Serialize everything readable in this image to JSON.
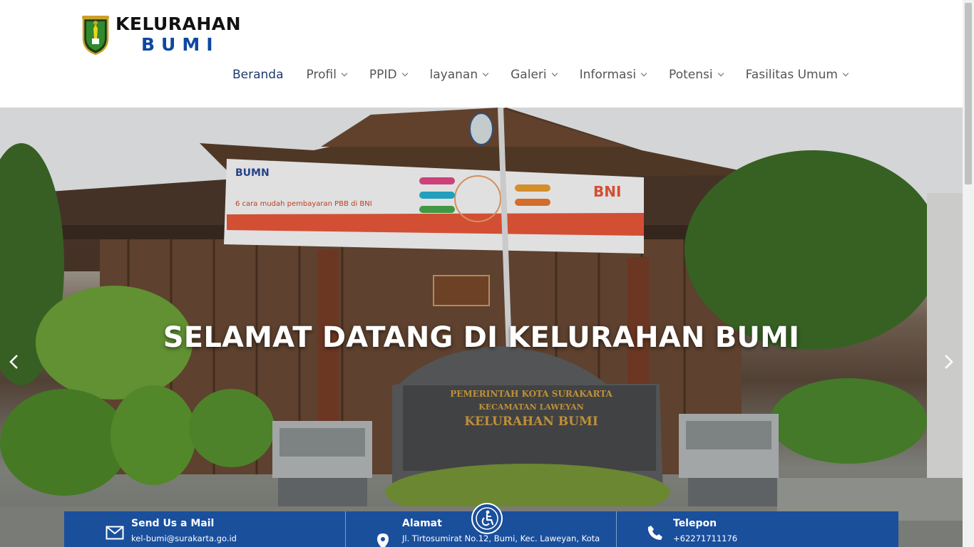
{
  "brand": {
    "name_top": "KELURAHAN",
    "name_bottom": "BUMI"
  },
  "nav": {
    "items": [
      {
        "label": "Beranda",
        "active": true,
        "has_dropdown": false
      },
      {
        "label": "Profil",
        "active": false,
        "has_dropdown": true
      },
      {
        "label": "PPID",
        "active": false,
        "has_dropdown": true
      },
      {
        "label": "layanan",
        "active": false,
        "has_dropdown": true
      },
      {
        "label": "Galeri",
        "active": false,
        "has_dropdown": true
      },
      {
        "label": "Informasi",
        "active": false,
        "has_dropdown": true
      },
      {
        "label": "Potensi",
        "active": false,
        "has_dropdown": true
      },
      {
        "label": "Fasilitas Umum",
        "active": false,
        "has_dropdown": true
      }
    ]
  },
  "hero": {
    "title": "SELAMAT DATANG DI KELURAHAN BUMI",
    "banner_bumn": "BUMN",
    "banner_text": "6 cara mudah pembayaran PBB di BNI",
    "banner_bank": "BNI",
    "sign_line1": "PEMERINTAH KOTA SURAKARTA",
    "sign_line2": "KECAMATAN LAWEYAN",
    "sign_line3": "KELURAHAN BUMI"
  },
  "info": {
    "mail_label": "Send Us a Mail",
    "mail_value": "kel-bumi@surakarta.go.id",
    "address_label": "Alamat",
    "address_value": "Jl. Tirtosumirat No.12, Bumi, Kec. Laweyan, Kota",
    "phone_label": "Telepon",
    "phone_value": "+62271711176"
  },
  "icons": {
    "prev": "chevron-left-icon",
    "next": "chevron-right-icon",
    "mail": "envelope-icon",
    "address": "map-pin-icon",
    "phone": "phone-icon",
    "accessibility": "accessibility-icon"
  },
  "colors": {
    "brand_blue": "#0d47a1",
    "infobar_blue": "#1a4f9c",
    "nav_active": "#1e3a6e"
  }
}
